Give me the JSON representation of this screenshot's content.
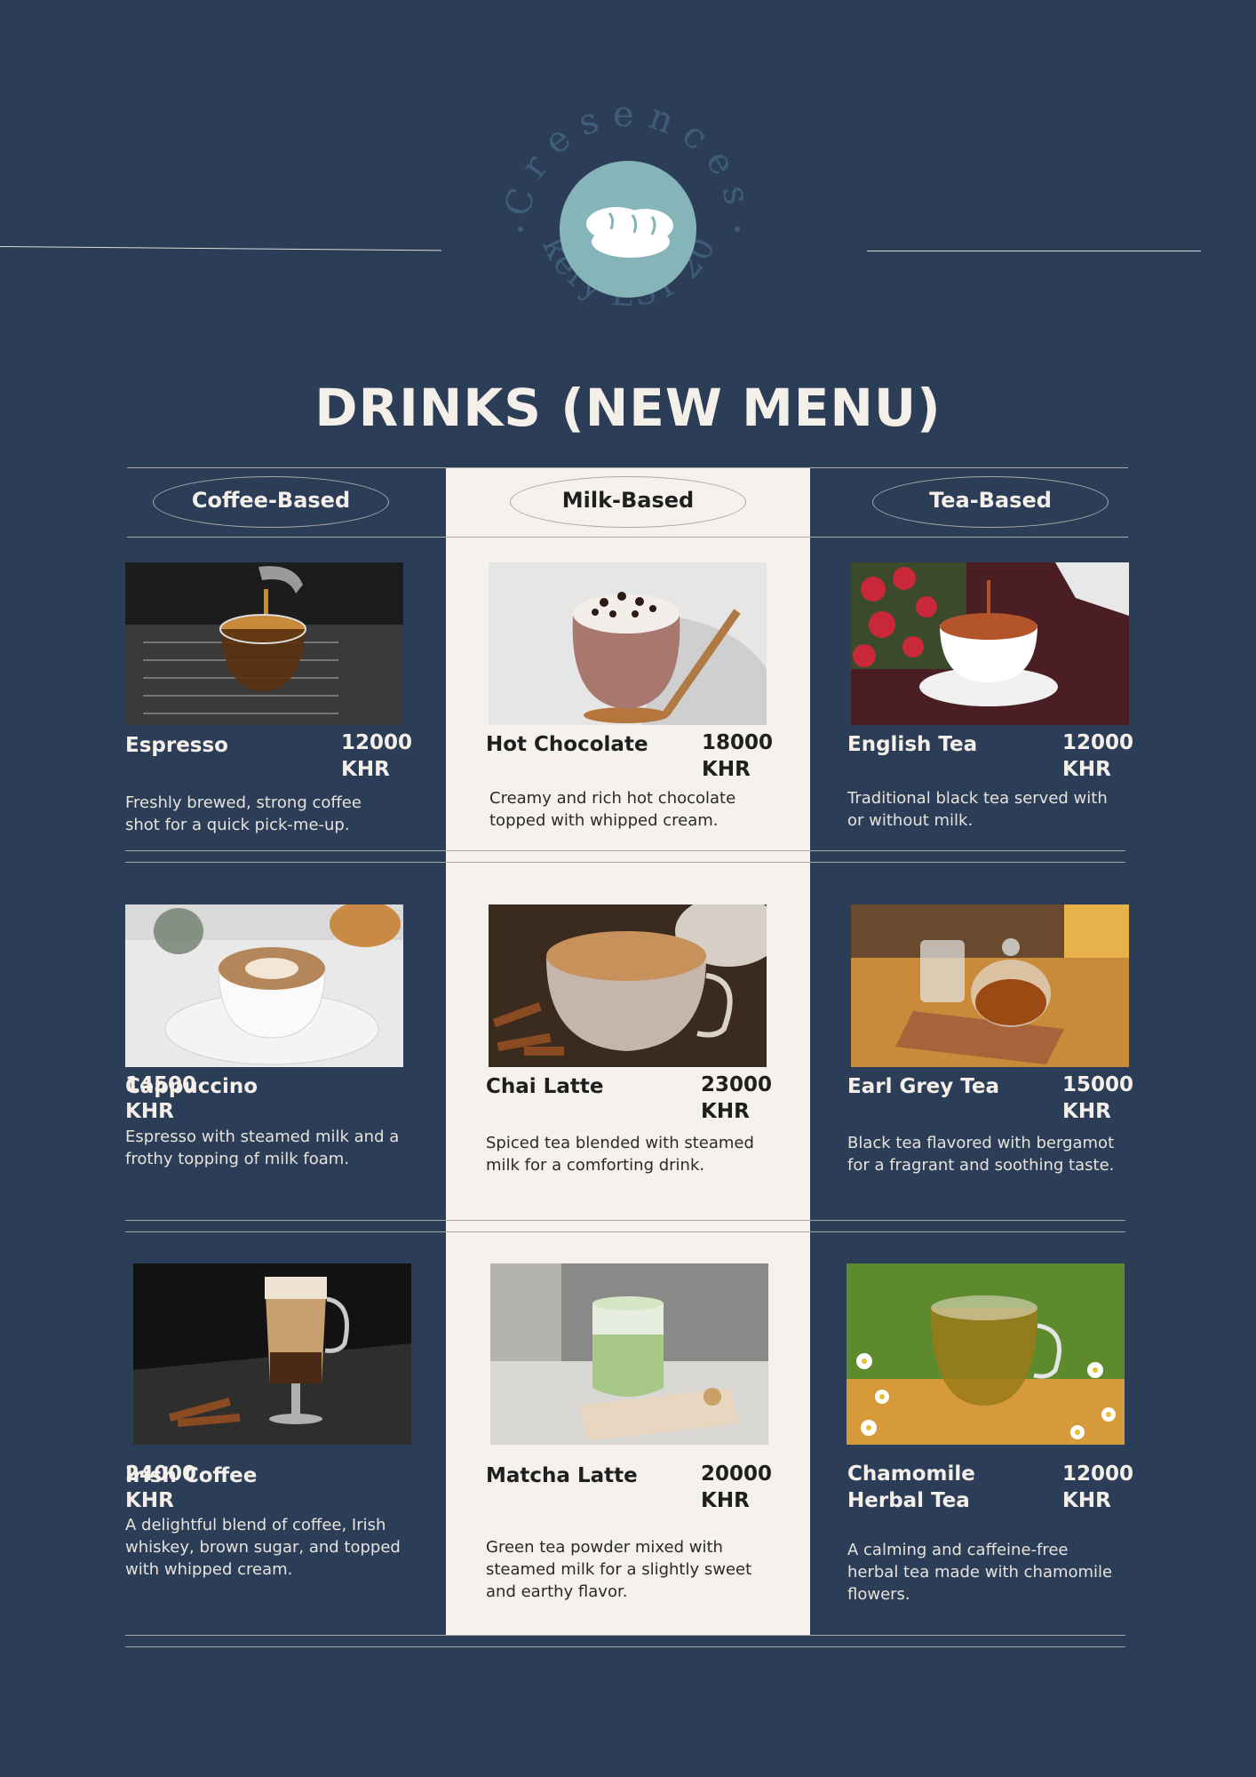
{
  "brand": {
    "name_arc": "Cresences",
    "tagline_arc": "Bakery EST 2023",
    "logo_icon": "bread-icon",
    "colors": {
      "background": "#2c3e57",
      "logo_circle": "#85b5b8",
      "arc_text": "#3d5d79",
      "milk_column": "#f5f1ec"
    }
  },
  "title": "DRINKS (NEW MENU)",
  "categories": [
    "Coffee-Based",
    "Milk-Based",
    "Tea-Based"
  ],
  "items": {
    "espresso": {
      "name": "Espresso",
      "price": "12000 KHR",
      "desc": "Freshly brewed, strong coffee shot for a quick pick-me-up."
    },
    "hot_chocolate": {
      "name": "Hot Chocolate",
      "price": "18000 KHR",
      "desc": "Creamy and rich hot chocolate topped with whipped cream."
    },
    "english_tea": {
      "name": "English Tea",
      "price": "12000 KHR",
      "desc": "Traditional black tea served with or without milk."
    },
    "cappuccino": {
      "name": "Cappuccino",
      "price": "14500 KHR",
      "desc": "Espresso with steamed milk and a frothy topping of milk foam."
    },
    "chai_latte": {
      "name": "Chai Latte",
      "price": "23000 KHR",
      "desc": "Spiced tea blended with steamed milk for a comforting drink."
    },
    "earl_grey": {
      "name": "Earl Grey Tea",
      "price": "15000 KHR",
      "desc": "Black tea flavored with bergamot for a fragrant and soothing taste."
    },
    "irish_coffee": {
      "name": "Irish Coffee",
      "price": "24000 KHR",
      "desc": "A delightful blend of coffee, Irish whiskey, brown sugar, and topped with whipped cream."
    },
    "matcha_latte": {
      "name": "Matcha Latte",
      "price": "20000 KHR",
      "desc": "Green tea powder mixed with steamed milk for a slightly sweet and earthy flavor."
    },
    "chamomile": {
      "name": "Chamomile Herbal Tea",
      "price": "12000 KHR",
      "desc": "A calming and caffeine-free herbal tea made with chamomile flowers."
    }
  }
}
